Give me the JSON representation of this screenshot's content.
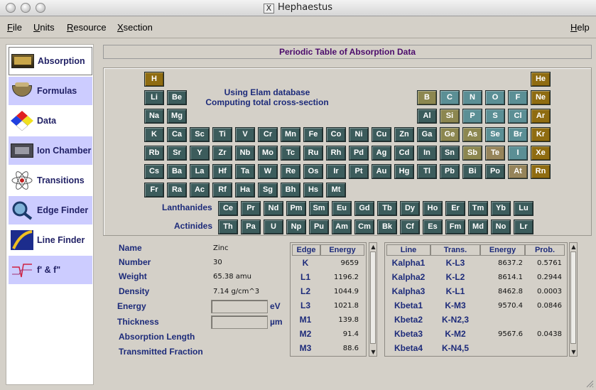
{
  "window": {
    "title": "Hephaestus"
  },
  "menubar": {
    "file": "File",
    "units": "Units",
    "resource": "Resource",
    "xsection": "Xsection",
    "help": "Help"
  },
  "sidebar": {
    "items": [
      {
        "label": "Absorption",
        "icon": "gold-bar-icon"
      },
      {
        "label": "Formulas",
        "icon": "mortar-icon"
      },
      {
        "label": "Data",
        "icon": "hazard-diamond-icon"
      },
      {
        "label": "Ion Chamber",
        "icon": "ion-chamber-icon"
      },
      {
        "label": "Transitions",
        "icon": "atom-icon"
      },
      {
        "label": "Edge Finder",
        "icon": "magnifier-icon"
      },
      {
        "label": "Line Finder",
        "icon": "spectrum-icon"
      },
      {
        "label": "f' & f\"",
        "icon": "anomalous-plot-icon"
      }
    ]
  },
  "heading": "Periodic Table of Absorption Data",
  "database": {
    "line1": "Using Elam database",
    "line2": "Computing total cross-section"
  },
  "rows": {
    "lanthanides": "Lanthanides",
    "actinides": "Actinides"
  },
  "colors": {
    "dark": "#3c5c5c",
    "gold": "#8f6c11",
    "olive": "#8c8750",
    "teal": "#5b8f95",
    "tan": "#96845a"
  },
  "elements": [
    {
      "s": "H",
      "c": "gold"
    },
    {
      "s": "He",
      "c": "gold"
    },
    {
      "s": "Li",
      "c": "dark"
    },
    {
      "s": "Be",
      "c": "dark"
    },
    {
      "s": "B",
      "c": "olive"
    },
    {
      "s": "C",
      "c": "teal"
    },
    {
      "s": "N",
      "c": "teal"
    },
    {
      "s": "O",
      "c": "teal"
    },
    {
      "s": "F",
      "c": "teal"
    },
    {
      "s": "Ne",
      "c": "gold"
    },
    {
      "s": "Na",
      "c": "dark"
    },
    {
      "s": "Mg",
      "c": "dark"
    },
    {
      "s": "Al",
      "c": "dark"
    },
    {
      "s": "Si",
      "c": "olive"
    },
    {
      "s": "P",
      "c": "teal"
    },
    {
      "s": "S",
      "c": "teal"
    },
    {
      "s": "Cl",
      "c": "teal"
    },
    {
      "s": "Ar",
      "c": "gold"
    },
    {
      "s": "K",
      "c": "dark"
    },
    {
      "s": "Ca",
      "c": "dark"
    },
    {
      "s": "Sc",
      "c": "dark"
    },
    {
      "s": "Ti",
      "c": "dark"
    },
    {
      "s": "V",
      "c": "dark"
    },
    {
      "s": "Cr",
      "c": "dark"
    },
    {
      "s": "Mn",
      "c": "dark"
    },
    {
      "s": "Fe",
      "c": "dark"
    },
    {
      "s": "Co",
      "c": "dark"
    },
    {
      "s": "Ni",
      "c": "dark"
    },
    {
      "s": "Cu",
      "c": "dark"
    },
    {
      "s": "Zn",
      "c": "dark"
    },
    {
      "s": "Ga",
      "c": "dark"
    },
    {
      "s": "Ge",
      "c": "olive"
    },
    {
      "s": "As",
      "c": "olive"
    },
    {
      "s": "Se",
      "c": "teal"
    },
    {
      "s": "Br",
      "c": "teal"
    },
    {
      "s": "Kr",
      "c": "gold"
    },
    {
      "s": "Rb",
      "c": "dark"
    },
    {
      "s": "Sr",
      "c": "dark"
    },
    {
      "s": "Y",
      "c": "dark"
    },
    {
      "s": "Zr",
      "c": "dark"
    },
    {
      "s": "Nb",
      "c": "dark"
    },
    {
      "s": "Mo",
      "c": "dark"
    },
    {
      "s": "Tc",
      "c": "dark"
    },
    {
      "s": "Ru",
      "c": "dark"
    },
    {
      "s": "Rh",
      "c": "dark"
    },
    {
      "s": "Pd",
      "c": "dark"
    },
    {
      "s": "Ag",
      "c": "dark"
    },
    {
      "s": "Cd",
      "c": "dark"
    },
    {
      "s": "In",
      "c": "dark"
    },
    {
      "s": "Sn",
      "c": "dark"
    },
    {
      "s": "Sb",
      "c": "olive"
    },
    {
      "s": "Te",
      "c": "tan"
    },
    {
      "s": "I",
      "c": "teal"
    },
    {
      "s": "Xe",
      "c": "gold"
    },
    {
      "s": "Cs",
      "c": "dark"
    },
    {
      "s": "Ba",
      "c": "dark"
    },
    {
      "s": "La",
      "c": "dark"
    },
    {
      "s": "Hf",
      "c": "dark"
    },
    {
      "s": "Ta",
      "c": "dark"
    },
    {
      "s": "W",
      "c": "dark"
    },
    {
      "s": "Re",
      "c": "dark"
    },
    {
      "s": "Os",
      "c": "dark"
    },
    {
      "s": "Ir",
      "c": "dark"
    },
    {
      "s": "Pt",
      "c": "dark"
    },
    {
      "s": "Au",
      "c": "dark"
    },
    {
      "s": "Hg",
      "c": "dark"
    },
    {
      "s": "Tl",
      "c": "dark"
    },
    {
      "s": "Pb",
      "c": "dark"
    },
    {
      "s": "Bi",
      "c": "dark"
    },
    {
      "s": "Po",
      "c": "dark"
    },
    {
      "s": "At",
      "c": "tan"
    },
    {
      "s": "Rn",
      "c": "gold"
    },
    {
      "s": "Fr",
      "c": "dark"
    },
    {
      "s": "Ra",
      "c": "dark"
    },
    {
      "s": "Ac",
      "c": "dark"
    },
    {
      "s": "Rf",
      "c": "dark"
    },
    {
      "s": "Ha",
      "c": "dark"
    },
    {
      "s": "Sg",
      "c": "dark"
    },
    {
      "s": "Bh",
      "c": "dark"
    },
    {
      "s": "Hs",
      "c": "dark"
    },
    {
      "s": "Mt",
      "c": "dark"
    },
    {
      "s": "Ce",
      "c": "dark"
    },
    {
      "s": "Pr",
      "c": "dark"
    },
    {
      "s": "Nd",
      "c": "dark"
    },
    {
      "s": "Pm",
      "c": "dark"
    },
    {
      "s": "Sm",
      "c": "dark"
    },
    {
      "s": "Eu",
      "c": "dark"
    },
    {
      "s": "Gd",
      "c": "dark"
    },
    {
      "s": "Tb",
      "c": "dark"
    },
    {
      "s": "Dy",
      "c": "dark"
    },
    {
      "s": "Ho",
      "c": "dark"
    },
    {
      "s": "Er",
      "c": "dark"
    },
    {
      "s": "Tm",
      "c": "dark"
    },
    {
      "s": "Yb",
      "c": "dark"
    },
    {
      "s": "Lu",
      "c": "dark"
    },
    {
      "s": "Th",
      "c": "dark"
    },
    {
      "s": "Pa",
      "c": "dark"
    },
    {
      "s": "U",
      "c": "dark"
    },
    {
      "s": "Np",
      "c": "dark"
    },
    {
      "s": "Pu",
      "c": "dark"
    },
    {
      "s": "Am",
      "c": "dark"
    },
    {
      "s": "Cm",
      "c": "dark"
    },
    {
      "s": "Bk",
      "c": "dark"
    },
    {
      "s": "Cf",
      "c": "dark"
    },
    {
      "s": "Es",
      "c": "dark"
    },
    {
      "s": "Fm",
      "c": "dark"
    },
    {
      "s": "Md",
      "c": "dark"
    },
    {
      "s": "No",
      "c": "dark"
    },
    {
      "s": "Lr",
      "c": "dark"
    }
  ],
  "info": {
    "labels": {
      "name": "Name",
      "number": "Number",
      "weight": "Weight",
      "density": "Density",
      "energy": "Energy",
      "thickness": "Thickness",
      "absorption_length": "Absorption Length",
      "transmitted_fraction": "Transmitted Fraction"
    },
    "values": {
      "name": "Zinc",
      "number": "30",
      "weight": "65.38 amu",
      "density": "7.14 g/cm^3"
    },
    "energy_field": {
      "value": "",
      "unit": "eV"
    },
    "thickness_field": {
      "value": "",
      "unit": "µm"
    }
  },
  "edges": {
    "headers": [
      "Edge",
      "Energy"
    ],
    "rows": [
      [
        "K",
        "9659"
      ],
      [
        "L1",
        "1196.2"
      ],
      [
        "L2",
        "1044.9"
      ],
      [
        "L3",
        "1021.8"
      ],
      [
        "M1",
        "139.8"
      ],
      [
        "M2",
        "91.4"
      ],
      [
        "M3",
        "88.6"
      ]
    ]
  },
  "lines": {
    "headers": [
      "Line",
      "Trans.",
      "Energy",
      "Prob."
    ],
    "rows": [
      [
        "Kalpha1",
        "K-L3",
        "8637.2",
        "0.5761"
      ],
      [
        "Kalpha2",
        "K-L2",
        "8614.1",
        "0.2944"
      ],
      [
        "Kalpha3",
        "K-L1",
        "8462.8",
        "0.0003"
      ],
      [
        "Kbeta1",
        "K-M3",
        "9570.4",
        "0.0846"
      ],
      [
        "Kbeta2",
        "K-N2,3",
        "",
        ""
      ],
      [
        "Kbeta3",
        "K-M2",
        "9567.6",
        "0.0438"
      ],
      [
        "Kbeta4",
        "K-N4,5",
        "",
        ""
      ]
    ]
  }
}
